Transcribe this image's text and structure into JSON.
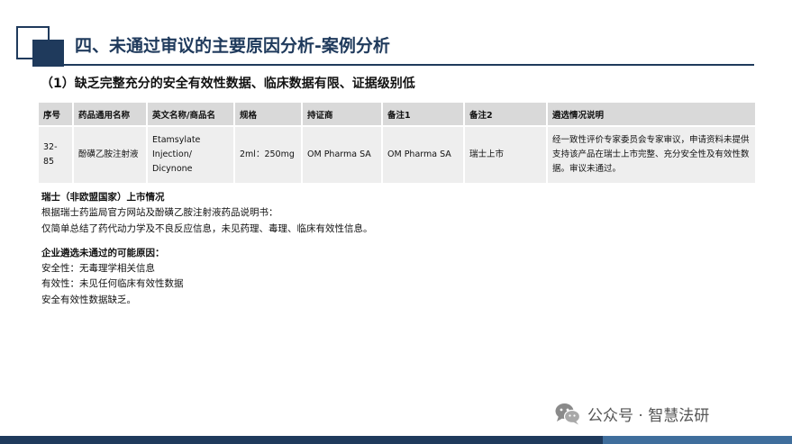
{
  "header": {
    "title": "四、未通过审议的主要原因分析-案例分析"
  },
  "section": {
    "heading": "（1）缺乏完整充分的安全有效性数据、临床数据有限、证据级别低"
  },
  "table": {
    "columns": [
      "序号",
      "药品通用名称",
      "英文名称/商品名",
      "规格",
      "持证商",
      "备注1",
      "备注2",
      "遴选情况说明"
    ],
    "rows": [
      {
        "no": "32-85",
        "generic_name": "酚磺乙胺注射液",
        "english_name": "Etamsylate Injection/ Dicynone",
        "spec": "2ml：250mg",
        "holder": "OM Pharma SA",
        "note1": "OM Pharma SA",
        "note2": "瑞士上市",
        "description": "经一致性评价专家委员会专家审议，申请资料未提供支持该产品在瑞士上市完整、充分安全性及有效性数据。审议未通过。"
      }
    ]
  },
  "notes": {
    "swiss_heading": "瑞士（非欧盟国家）上市情况",
    "swiss_line1": "根据瑞士药监局官方网站及酚磺乙胺注射液药品说明书：",
    "swiss_line2": "仅简单总结了药代动力学及不良反应信息，未见药理、毒理、临床有效性信息。",
    "reason_heading": "企业遴选未通过的可能原因：",
    "reason_safety": "安全性：无毒理学相关信息",
    "reason_efficacy": "有效性：未见任何临床有效性数据",
    "reason_summary": "安全有效性数据缺乏。"
  },
  "watermark": {
    "icon": "wechat-icon",
    "text": "公众号 · 智慧法研"
  },
  "colors": {
    "brand": "#1f3a5c",
    "accent": "#3f6e9c",
    "table_header": "#d9d9d9",
    "table_body": "#eeeeee"
  }
}
